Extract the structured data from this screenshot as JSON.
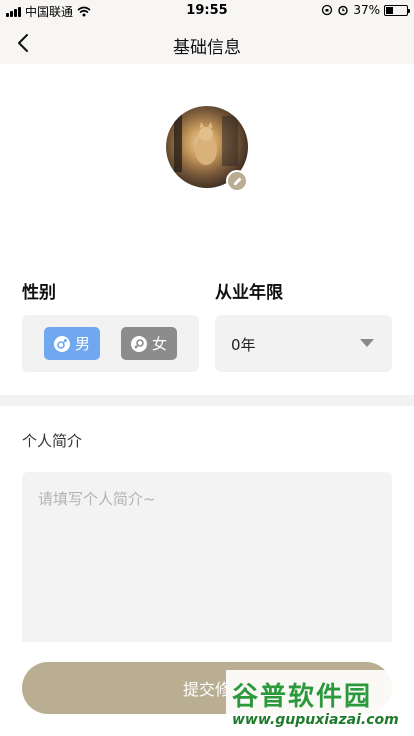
{
  "status_bar": {
    "carrier": "中国联通",
    "time": "19:55",
    "battery": "37%",
    "battery_level": 0.37
  },
  "nav": {
    "title": "基础信息",
    "back_icon": "chevron-left-icon"
  },
  "avatar": {
    "edit_icon": "pencil-icon"
  },
  "gender": {
    "label": "性别",
    "options": [
      {
        "label": "男",
        "icon": "male-icon",
        "selected": true,
        "color": "#6fa8ee"
      },
      {
        "label": "女",
        "icon": "female-icon",
        "selected": false,
        "color": "#8c8c8c"
      }
    ]
  },
  "experience": {
    "label": "从业年限",
    "value": "0年",
    "caret_icon": "caret-down-icon"
  },
  "bio": {
    "label": "个人简介",
    "placeholder": "请填写个人简介~",
    "value": ""
  },
  "submit": {
    "label": "提交修",
    "color": "#b9ad92"
  },
  "watermark": {
    "brand": "谷普软件园",
    "url": "www.gupuxiazai.com"
  }
}
